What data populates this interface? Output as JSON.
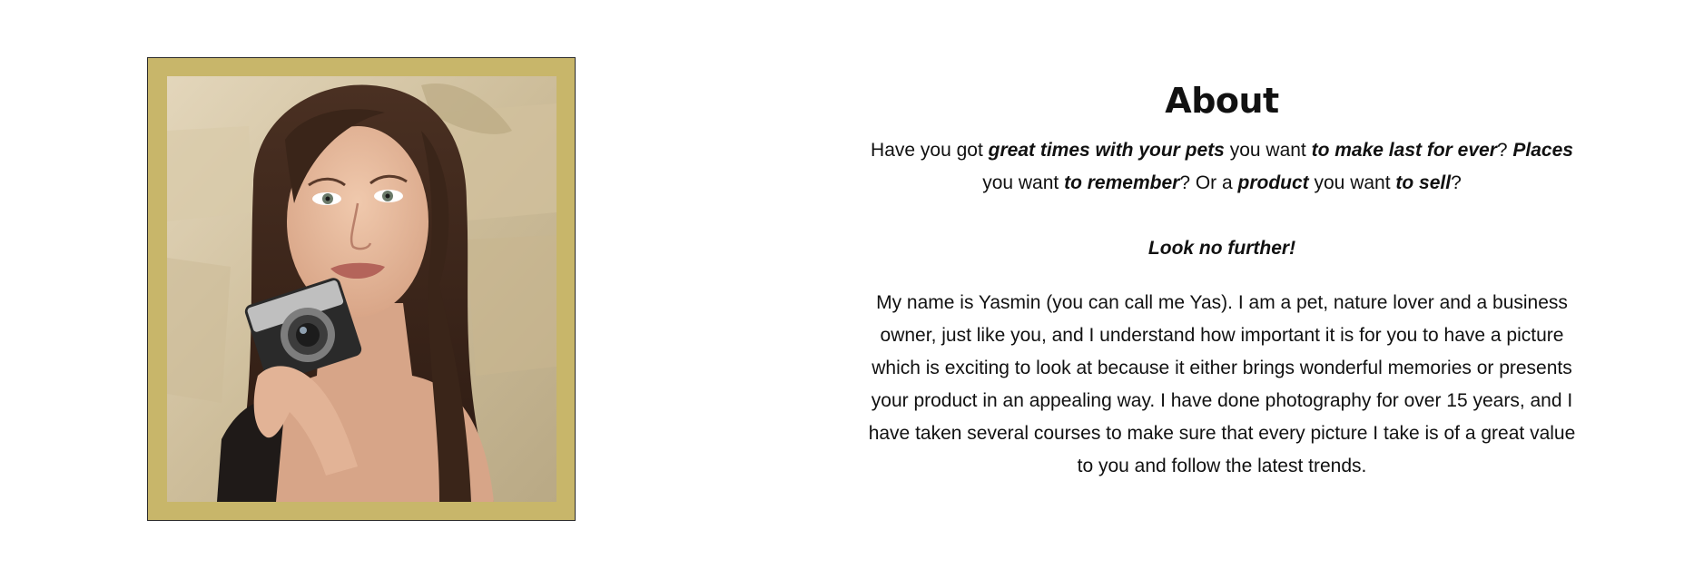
{
  "photo": {
    "alt": "Woman holding a vintage camera",
    "frame_color": "#c8b66a"
  },
  "about": {
    "title": "About",
    "intro": [
      {
        "text": "Have you got ",
        "emph": false
      },
      {
        "text": "great times with your pets",
        "emph": true
      },
      {
        "text": " you want ",
        "emph": false
      },
      {
        "text": "to make last for ever",
        "emph": true
      },
      {
        "text": "? ",
        "emph": false
      },
      {
        "text": "Places",
        "emph": true
      },
      {
        "text": " you want ",
        "emph": false
      },
      {
        "text": "to remember",
        "emph": true
      },
      {
        "text": "? Or a ",
        "emph": false
      },
      {
        "text": "product",
        "emph": true
      },
      {
        "text": " you want ",
        "emph": false
      },
      {
        "text": "to sell",
        "emph": true
      },
      {
        "text": "?",
        "emph": false
      }
    ],
    "cta": "Look no further!",
    "body": "My name is Yasmin (you can call me Yas). I am a pet, nature lover and a business owner, just like you, and I understand how important it is for you to have a picture which is exciting to look at because it either brings wonderful memories or presents your product in an appealing way. I have done photography for over 15 years, and I have taken several courses to make sure that every picture I take is of a great value to you and follow the latest trends."
  }
}
